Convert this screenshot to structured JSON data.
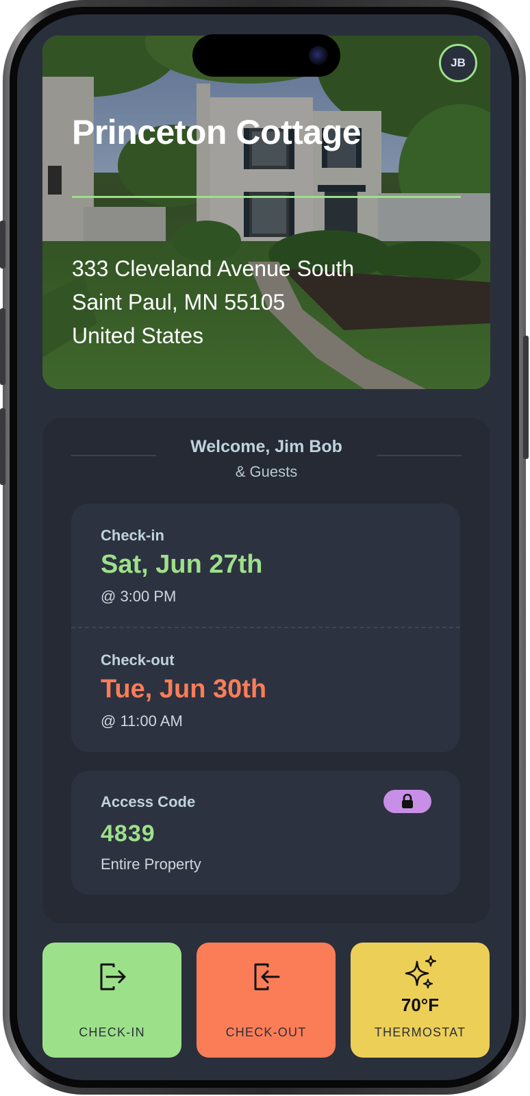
{
  "property": {
    "name": "Princeton Cottage",
    "address_line1": "333 Cleveland Avenue South",
    "address_line2": "Saint Paul, MN 55105",
    "address_line3": "United States"
  },
  "user": {
    "initials": "JB"
  },
  "welcome": {
    "title": "Welcome, Jim Bob",
    "subtitle": "& Guests"
  },
  "checkin": {
    "label": "Check-in",
    "date": "Sat, Jun 27th",
    "time": "@ 3:00 PM"
  },
  "checkout": {
    "label": "Check-out",
    "date": "Tue, Jun 30th",
    "time": "@ 11:00 AM"
  },
  "access": {
    "label": "Access Code",
    "code": "4839",
    "scope": "Entire Property"
  },
  "actions": {
    "checkin_label": "CHECK-IN",
    "checkout_label": "CHECK-OUT",
    "thermostat_label": "THERMOSTAT",
    "thermostat_temp": "70°F"
  },
  "colors": {
    "accent_green": "#9de08a",
    "accent_orange": "#fb7d57",
    "accent_yellow": "#eccf57",
    "lock_purple": "#c88fe6",
    "background": "#2a2f3c"
  },
  "icons": {
    "checkin": "door-enter-icon",
    "checkout": "door-exit-icon",
    "thermostat": "sparkles-icon",
    "access": "lock-icon"
  }
}
